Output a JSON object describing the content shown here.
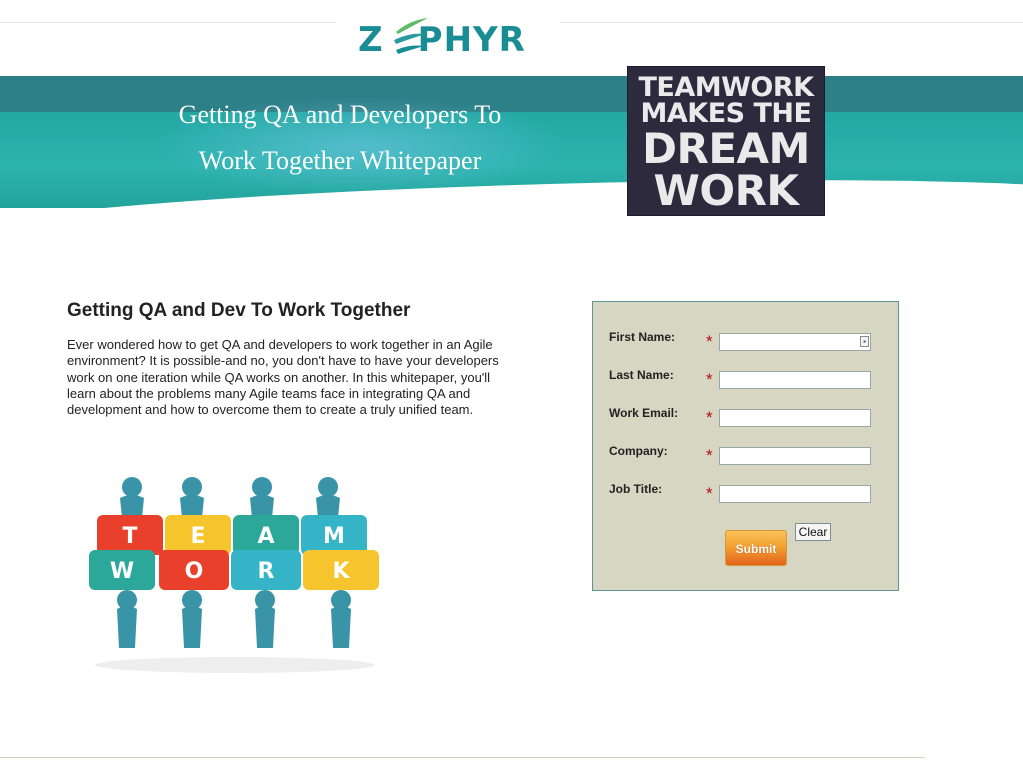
{
  "logo": {
    "text_prefix": "Z",
    "text_suffix": "PHYR",
    "brand_color": "#1a8c94"
  },
  "banner": {
    "title_line1": "Getting QA and Developers To",
    "title_line2": "Work Together Whitepaper",
    "colors": {
      "top": "#2d7f88",
      "main": "#2bb3ae"
    }
  },
  "poster": {
    "line1": "TEAMWORK",
    "line2": "MAKES THE",
    "line3": "DREAM",
    "line4": "WORK"
  },
  "content": {
    "heading": "Getting QA and Dev To Work Together",
    "paragraph": "Ever wondered how to get QA and developers to work together in an Agile environment? It is possible-and no, you don't have to have your developers work on one iteration while QA works on another. In this whitepaper, you'll learn about the problems many Agile teams face in integrating QA and development and how to overcome them to create a truly unified team."
  },
  "illustration": {
    "top_letters": [
      "T",
      "E",
      "A",
      "M"
    ],
    "bottom_letters": [
      "W",
      "O",
      "R",
      "K"
    ],
    "piece_colors": [
      "#e8402a",
      "#f6c52e",
      "#2ba89a",
      "#35b4c8"
    ]
  },
  "form": {
    "required_marker": "*",
    "fields": [
      {
        "label": "First Name:",
        "value": ""
      },
      {
        "label": "Last Name:",
        "value": ""
      },
      {
        "label": "Work Email:",
        "value": ""
      },
      {
        "label": "Company:",
        "value": ""
      },
      {
        "label": "Job Title:",
        "value": ""
      }
    ],
    "submit_label": "Submit",
    "clear_label": "Clear",
    "panel_color": "#d6d6c2"
  }
}
